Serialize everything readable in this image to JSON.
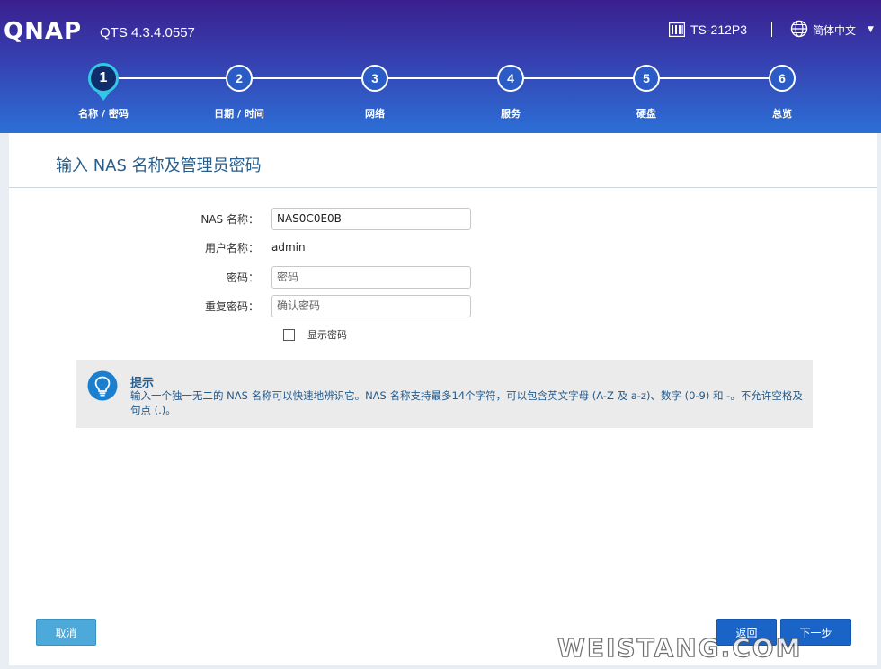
{
  "header": {
    "logo": "QNAP",
    "version": "QTS 4.3.4.0557",
    "model": "TS-212P3",
    "language": "简体中文"
  },
  "steps": [
    {
      "number": "1",
      "label": "名称 / 密码",
      "active": true
    },
    {
      "number": "2",
      "label": "日期 / 时间",
      "active": false
    },
    {
      "number": "3",
      "label": "网络",
      "active": false
    },
    {
      "number": "4",
      "label": "服务",
      "active": false
    },
    {
      "number": "5",
      "label": "硬盘",
      "active": false
    },
    {
      "number": "6",
      "label": "总览",
      "active": false
    }
  ],
  "page": {
    "title": "输入 NAS 名称及管理员密码"
  },
  "form": {
    "nas_name_label": "NAS 名称：",
    "nas_name_value": "NAS0C0E0B",
    "username_label": "用户名称：",
    "username_value": "admin",
    "password_label": "密码：",
    "password_placeholder": "密码",
    "confirm_label": "重复密码：",
    "confirm_placeholder": "确认密码",
    "show_password_label": "显示密码"
  },
  "tip": {
    "title": "提示",
    "text": "输入一个独一无二的 NAS 名称可以快速地辨识它。NAS 名称支持最多14个字符，可以包含英文字母 (A-Z 及 a-z)、数字 (0-9) 和 -。不允许空格及句点 (.)。"
  },
  "buttons": {
    "cancel": "取消",
    "back": "返回",
    "next": "下一步"
  },
  "watermark": "WEISTANG.COM",
  "colors": {
    "header_top": "#3a1f8e",
    "header_bottom": "#2c6fd6",
    "active_step_ring": "#33c7e6",
    "primary_button": "#1a64c7",
    "cancel_button": "#4da9d9",
    "title_text": "#2a5e8a"
  }
}
